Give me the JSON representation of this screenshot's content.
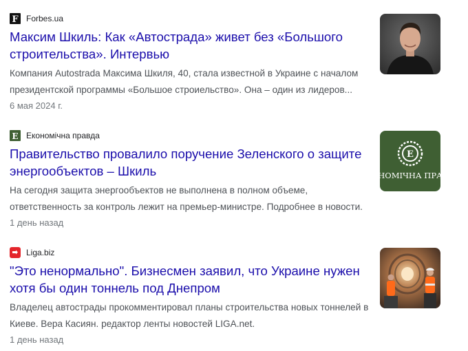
{
  "articles": [
    {
      "source": "Forbes.ua",
      "favicon": "forbes-f-icon",
      "title": "Максим Шкиль: Как «Автострада» живет без «Большого строительства». Интервью",
      "snippet": "Компания Autostrada Максима Шкиля, 40, стала известной в Украине с началом президентской программы «Большое строиельство». Она – один из лидеров...",
      "date": "6 мая 2024 г."
    },
    {
      "source": "Економічна правда",
      "favicon": "ekonomichna-pravda-e-icon",
      "title": "Правительство провалило поручение Зеленского о защите энергообъектов – Шкиль",
      "snippet": "На сегодня защита энергообъектов не выполнена в полном объеме, ответственность за контроль лежит на премьер-министре. Подробнее в новости.",
      "date": "1 день назад",
      "thumb_text": "НОМІЧНА ПРА"
    },
    {
      "source": "Liga.biz",
      "favicon": "liga-icon",
      "title": "\"Это ненормально\". Бизнесмен заявил, что Украине нужен хотя бы один тоннель под Днепром",
      "snippet": "Владелец автострады прокомментировал планы строительства новых тоннелей в Киеве. Вера Касиян. редактор ленты новостей LIGA.net.",
      "date": "1 день назад"
    }
  ],
  "colors": {
    "title_link": "#1a0dab",
    "snippet": "#4d5156",
    "date": "#70757a",
    "ep_green": "#3f5f33",
    "liga_red": "#e4252b"
  }
}
